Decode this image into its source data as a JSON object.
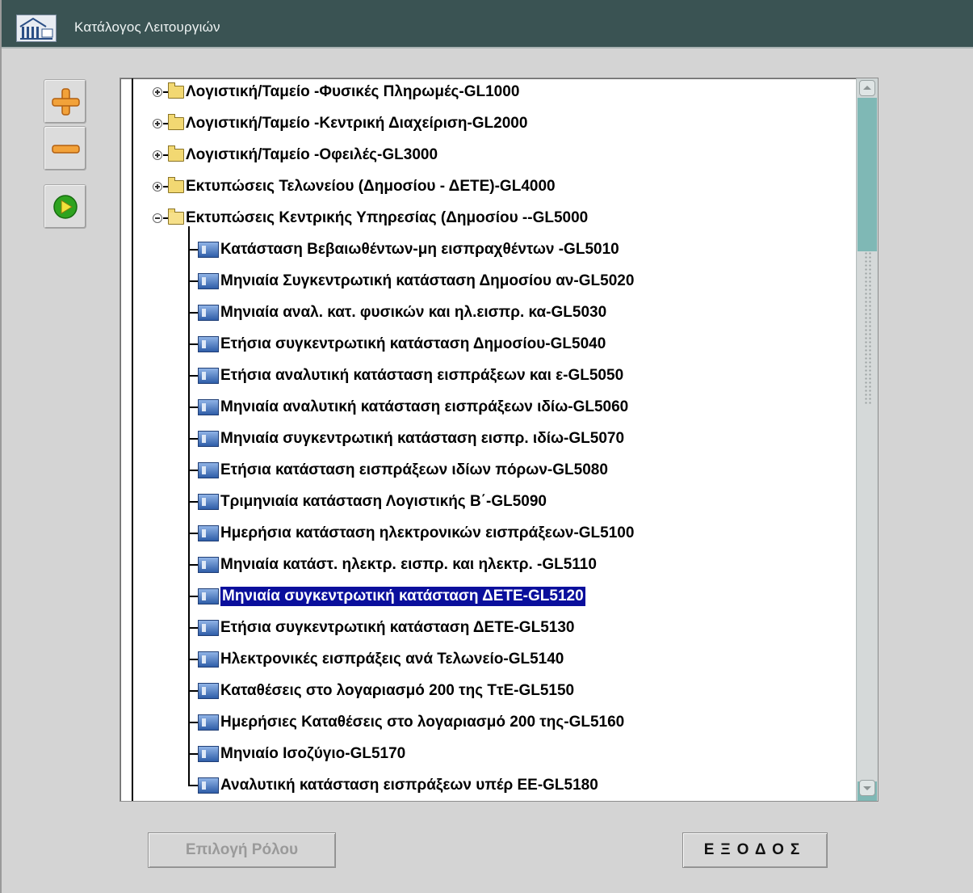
{
  "window": {
    "title": "Κατάλογος Λειτουργιών"
  },
  "toolbar": {
    "expand_icon": "plus-icon",
    "collapse_icon": "minus-icon",
    "run_icon": "play-icon"
  },
  "tree": {
    "folders": [
      {
        "label": "Λογιστική/Ταμείο -Φυσικές Πληρωμές-GL1000",
        "expanded": false
      },
      {
        "label": "Λογιστική/Ταμείο -Κεντρική Διαχείριση-GL2000",
        "expanded": false
      },
      {
        "label": "Λογιστική/Ταμείο -Οφειλές-GL3000",
        "expanded": false
      },
      {
        "label": "Εκτυπώσεις  Τελωνείου (Δημοσίου - ΔΕΤΕ)-GL4000",
        "expanded": false
      },
      {
        "label": "Εκτυπώσεις  Κεντρικής Υπηρεσίας (Δημοσίου --GL5000",
        "expanded": true
      }
    ],
    "items": [
      {
        "label": "Κατάσταση Βεβαιωθέντων-μη εισπραχθέντων -GL5010",
        "selected": false
      },
      {
        "label": "Μηνιαία Συγκεντρωτική κατάσταση Δημοσίου αν-GL5020",
        "selected": false
      },
      {
        "label": "Μηνιαία αναλ. κατ. φυσικών και ηλ.εισπρ. κα-GL5030",
        "selected": false
      },
      {
        "label": "Ετήσια συγκεντρωτική κατάσταση Δημοσίου-GL5040",
        "selected": false
      },
      {
        "label": "Ετήσια αναλυτική κατάσταση εισπράξεων και ε-GL5050",
        "selected": false
      },
      {
        "label": "Μηνιαία αναλυτική κατάσταση εισπράξεων ιδίω-GL5060",
        "selected": false
      },
      {
        "label": "Μηνιαία συγκεντρωτική κατάσταση εισπρ. ιδίω-GL5070",
        "selected": false
      },
      {
        "label": "Ετήσια κατάσταση εισπράξεων ιδίων πόρων-GL5080",
        "selected": false
      },
      {
        "label": "Τριμηνιαία κατάσταση Λογιστικής Β΄-GL5090",
        "selected": false
      },
      {
        "label": "Ημερήσια κατάσταση ηλεκτρονικών εισπράξεων-GL5100",
        "selected": false
      },
      {
        "label": "Μηνιαία κατάστ. ηλεκτρ. εισπρ. και ηλεκτρ. -GL5110",
        "selected": false
      },
      {
        "label": "Μηνιαία συγκεντρωτική κατάσταση ΔΕΤΕ-GL5120",
        "selected": true
      },
      {
        "label": "Ετήσια συγκεντρωτική κατάσταση ΔΕΤΕ-GL5130",
        "selected": false
      },
      {
        "label": "Ηλεκτρονικές εισπράξεις ανά Τελωνείο-GL5140",
        "selected": false
      },
      {
        "label": "Καταθέσεις στο λογαριασμό 200 της ΤτΕ-GL5150",
        "selected": false
      },
      {
        "label": "Ημερήσιες Καταθέσεις στο λογαριασμό 200 της-GL5160",
        "selected": false
      },
      {
        "label": "Μηνιαίο Ισοζύγιο-GL5170",
        "selected": false
      },
      {
        "label": "Αναλυτική κατάσταση εισπράξεων υπέρ ΕΕ-GL5180",
        "selected": false
      }
    ]
  },
  "buttons": {
    "select_role": "Επιλογή Ρόλου",
    "exit": "ΕΞΟΔΟΣ"
  },
  "colors": {
    "titlebar": "#3a5353",
    "selection": "#0a0f9c",
    "scroll_track": "#7fb8b5"
  }
}
